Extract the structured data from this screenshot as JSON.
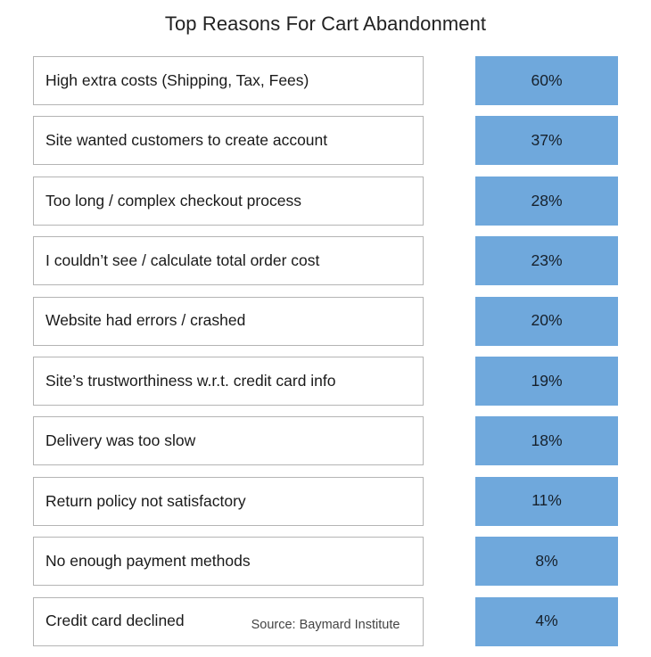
{
  "chart_data": {
    "type": "bar",
    "title": "Top Reasons For Cart Abandonment",
    "xlabel": "",
    "ylabel": "",
    "grid": false,
    "legend": "none",
    "orientation": "horizontal",
    "bar_color": "#6fa8dc",
    "label_box_border_color": "#b4b4b4",
    "note": "Bars are drawn as uniform-width boxes with the percentage printed inside; they are not scaled to value.",
    "categories": [
      "High extra costs (Shipping, Tax, Fees)",
      "Site wanted customers to create account",
      "Too long / complex checkout process",
      "I couldn’t see / calculate total order cost",
      "Website had errors / crashed",
      "Site’s trustworthiness w.r.t. credit card info",
      "Delivery was too slow",
      "Return policy not satisfactory",
      "No enough payment methods",
      "Credit card declined"
    ],
    "values": [
      60,
      37,
      28,
      23,
      20,
      19,
      18,
      11,
      8,
      4
    ],
    "value_labels": [
      "60%",
      "37%",
      "28%",
      "23%",
      "20%",
      "19%",
      "18%",
      "11%",
      "8%",
      "4%"
    ],
    "ylim": [
      0,
      60
    ],
    "source": "Source: Baymard Institute"
  },
  "rows": [
    {
      "label": "High extra costs (Shipping, Tax, Fees)",
      "value_label": "60%",
      "value": 60
    },
    {
      "label": "Site wanted customers to create account",
      "value_label": "37%",
      "value": 37
    },
    {
      "label": "Too long / complex checkout process",
      "value_label": "28%",
      "value": 28
    },
    {
      "label": "I couldn’t see / calculate total order cost",
      "value_label": "23%",
      "value": 23
    },
    {
      "label": "Website had errors / crashed",
      "value_label": "20%",
      "value": 20
    },
    {
      "label": "Site’s trustworthiness w.r.t. credit card info",
      "value_label": "19%",
      "value": 19
    },
    {
      "label": "Delivery was too slow",
      "value_label": "18%",
      "value": 18
    },
    {
      "label": "Return policy not satisfactory",
      "value_label": "11%",
      "value": 11
    },
    {
      "label": "No enough payment methods",
      "value_label": "8%",
      "value": 8
    },
    {
      "label": "Credit card declined",
      "value_label": "4%",
      "value": 4
    }
  ],
  "title": "Top Reasons For Cart Abandonment",
  "source": "Source: Baymard Institute"
}
